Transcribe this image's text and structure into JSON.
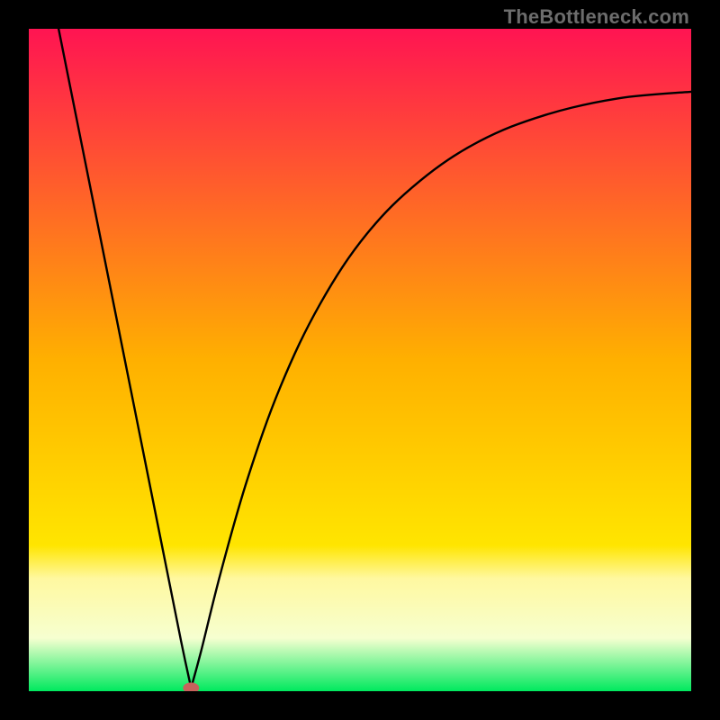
{
  "watermark": "TheBottleneck.com",
  "chart_data": {
    "type": "line",
    "title": "",
    "xlabel": "",
    "ylabel": "",
    "xlim": [
      0,
      1
    ],
    "ylim": [
      0,
      1
    ],
    "minimum_x": 0.245,
    "marker": {
      "x": 0.245,
      "y": 0.005,
      "color": "#c8625c"
    },
    "gradient_stops": [
      {
        "t": 0.0,
        "color": "#ff1452"
      },
      {
        "t": 0.5,
        "color": "#ffb000"
      },
      {
        "t": 0.78,
        "color": "#ffe500"
      },
      {
        "t": 0.83,
        "color": "#fff8a0"
      },
      {
        "t": 0.92,
        "color": "#f6ffd0"
      },
      {
        "t": 1.0,
        "color": "#00e95e"
      }
    ],
    "left_branch": [
      {
        "x": 0.045,
        "y": 1.0
      },
      {
        "x": 0.08,
        "y": 0.825
      },
      {
        "x": 0.12,
        "y": 0.625
      },
      {
        "x": 0.16,
        "y": 0.425
      },
      {
        "x": 0.2,
        "y": 0.225
      },
      {
        "x": 0.23,
        "y": 0.075
      },
      {
        "x": 0.245,
        "y": 0.005
      }
    ],
    "right_branch": [
      {
        "x": 0.245,
        "y": 0.005
      },
      {
        "x": 0.26,
        "y": 0.06
      },
      {
        "x": 0.29,
        "y": 0.18
      },
      {
        "x": 0.33,
        "y": 0.32
      },
      {
        "x": 0.38,
        "y": 0.46
      },
      {
        "x": 0.44,
        "y": 0.585
      },
      {
        "x": 0.51,
        "y": 0.69
      },
      {
        "x": 0.59,
        "y": 0.77
      },
      {
        "x": 0.68,
        "y": 0.83
      },
      {
        "x": 0.78,
        "y": 0.87
      },
      {
        "x": 0.89,
        "y": 0.895
      },
      {
        "x": 1.0,
        "y": 0.905
      }
    ]
  }
}
